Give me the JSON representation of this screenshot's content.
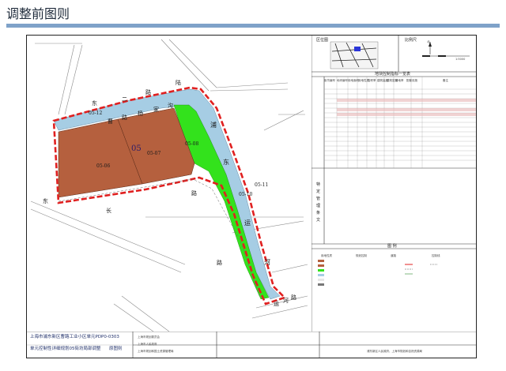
{
  "page": {
    "heading": "调整前图则"
  },
  "map": {
    "labels": {
      "block_number": "05",
      "parcel_a": "05-06",
      "parcel_b": "05-07",
      "parcel_c": "05-12",
      "parcel_d": "05-08",
      "parcel_e": "05-11",
      "parcel_f": "05-10",
      "road_north_1": "东",
      "road_north_2": "路",
      "road_north_3": "二",
      "road_north_4": "陆",
      "canal_1": "曹",
      "canal_2": "路",
      "canal_3": "杨",
      "canal_4": "家",
      "canal_5": "沟",
      "river_1": "浦",
      "river_2": "东",
      "river_3": "运",
      "river_4": "河",
      "road_mid": "路",
      "road_left": "东",
      "road_left2": "长",
      "road_bottom": "路",
      "road_bottom2": "运",
      "road_bottom3": "河",
      "road_bottom4": "路"
    },
    "colors": {
      "residential": "#b5603e",
      "green": "#33e21c",
      "water": "#a6cde4",
      "boundary": "#e02020",
      "road_line": "#7a7a7a"
    }
  },
  "title_block": {
    "line1": "上海市浦东新区曹路工业小区单元PDP0-0303",
    "line2": "单元控制性详细规划05街坊局部调整",
    "line2_suffix": "原图则",
    "col_a": "上海市规划委员会",
    "col_b": "上海市人民政府",
    "col_c": "上海市规划和国土资源管理局",
    "bottom_right": "浦东新区人民政府、上海市规划和自然资源局"
  },
  "side_panel": {
    "location_label": "区位图",
    "scale_label": "比例尺",
    "scale_north": "北",
    "scale_value": "1:5000",
    "table_title": "地块控制指标一览表",
    "notes_title": "特定管理条文",
    "legend_title": "图 例",
    "legend_groups": [
      "用地性质",
      "规划控制",
      "道路",
      "控制线"
    ],
    "table_headers": [
      "街坊编号",
      "地块编号",
      "用地面积",
      "用地性质",
      "容积率",
      "建筑高度",
      "建筑密度",
      "绿地率",
      "配套设施",
      "备注"
    ]
  }
}
